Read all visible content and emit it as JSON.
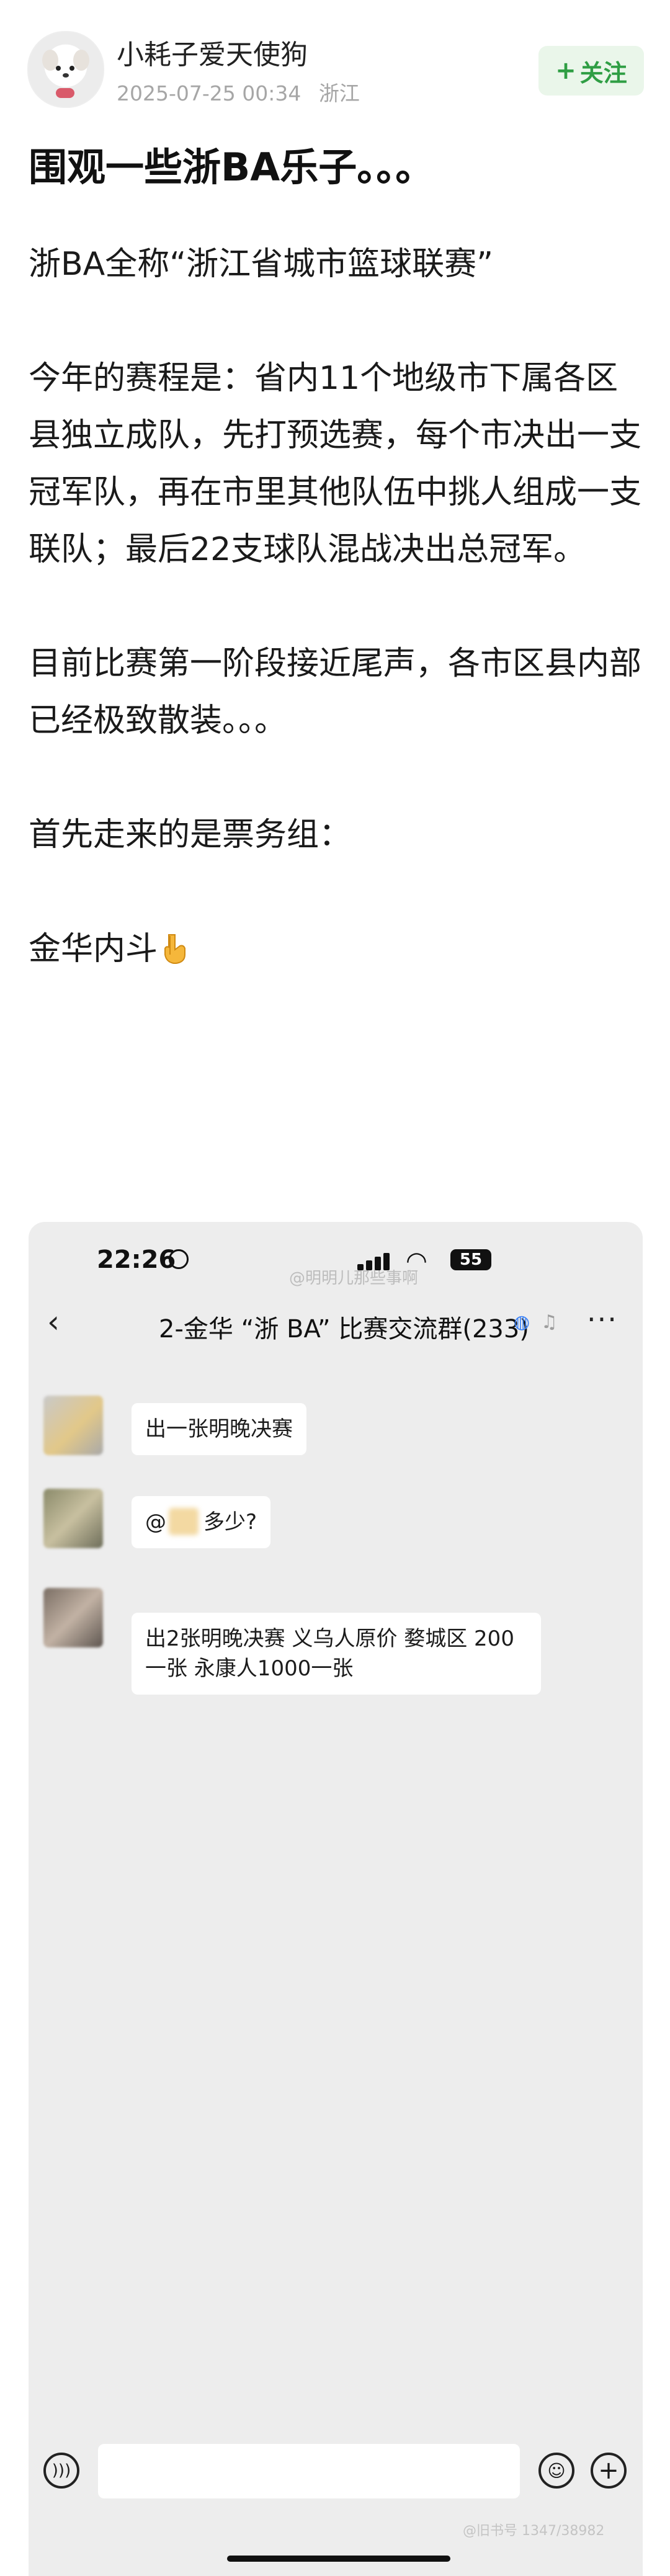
{
  "post": {
    "author": "小耗子爱天使狗",
    "date": "2025-07-25 00:34",
    "location": "浙江",
    "follow_label": "关注",
    "title": "围观一些浙BA乐子。。。",
    "paragraphs": [
      "浙BA全称“浙江省城市篮球联赛”",
      "今年的赛程是：省内11个地级市下属各区县独立成队，先打预选赛，每个市决出一支冠军队，再在市里其他队伍中挑人组成一支联队；最后22支球队混战决出总冠军。",
      "目前比赛第一阶段接近尾声，各市区县内部已经极致散装。。。",
      "首先走来的是票务组：",
      "金华内斗"
    ],
    "last_emoji": "pointing-down-hand-icon"
  },
  "screenshot": {
    "status_time": "22:26",
    "battery": "55",
    "watermark": "@明明儿那些事啊",
    "chat_title": "2-金华 “浙 BA” 比赛交流群(233)",
    "messages": [
      {
        "text": "出一张明晚决赛"
      },
      {
        "prefix": "@",
        "text": "多少?"
      },
      {
        "text": "出2张明晚决赛 义乌人原价 婺城区 200一张 永康人1000一张"
      }
    ],
    "bottom_watermark": "@旧书号 1347/38982"
  },
  "colors": {
    "accent_green": "#2f9e44",
    "follow_bg": "#eaf6ea",
    "chat_bg": "#ededed"
  }
}
